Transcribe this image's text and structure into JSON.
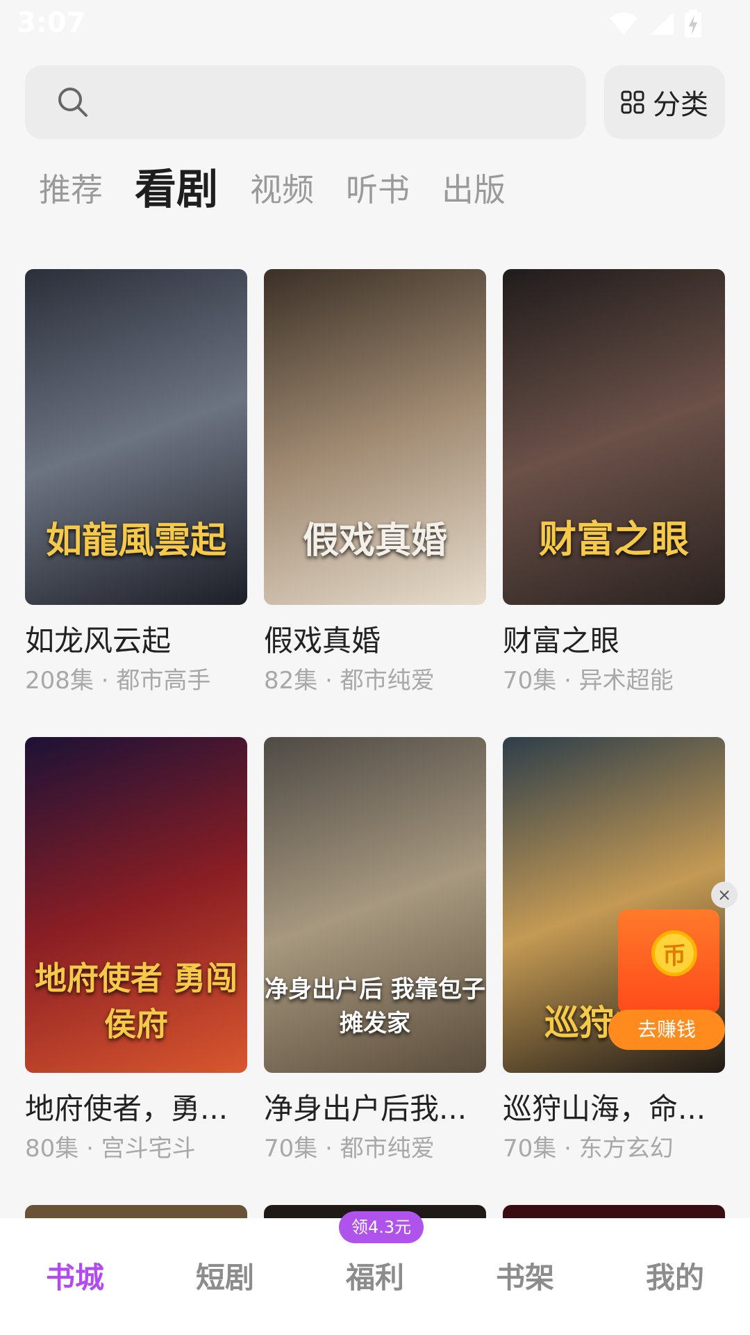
{
  "status_bar": {
    "time": "3:07"
  },
  "search": {
    "placeholder": ""
  },
  "category_button": {
    "label": "分类"
  },
  "tabs": [
    {
      "label": "推荐",
      "active": false
    },
    {
      "label": "看剧",
      "active": true
    },
    {
      "label": "视频",
      "active": false
    },
    {
      "label": "听书",
      "active": false
    },
    {
      "label": "出版",
      "active": false
    }
  ],
  "dramas": [
    {
      "poster_text": "如龍風雲起",
      "title": "如龙风云起",
      "meta": "208集 · 都市高手",
      "colors": [
        "#2b2f3a",
        "#6c7381",
        "#1d1f27"
      ]
    },
    {
      "poster_text": "假戏真婚",
      "title": "假戏真婚",
      "meta": "82集 · 都市纯爱",
      "colors": [
        "#3b3026",
        "#a08a72",
        "#e7dccc"
      ]
    },
    {
      "poster_text": "财富之眼",
      "title": "财富之眼",
      "meta": "70集 · 异术超能",
      "colors": [
        "#201c1c",
        "#6b5148",
        "#2a2220"
      ]
    },
    {
      "poster_text": "地府使者 勇闯侯府",
      "title": "地府使者，勇...",
      "meta": "80集 · 宫斗宅斗",
      "colors": [
        "#1c1236",
        "#8a1e24",
        "#d9572e"
      ]
    },
    {
      "poster_text": "净身出户后 我靠包子摊发家",
      "title": "净身出户后我...",
      "meta": "70集 · 都市纯爱",
      "colors": [
        "#4e4a45",
        "#a7987f",
        "#5b4d3c"
      ]
    },
    {
      "poster_text": "巡狩山海",
      "title": "巡狩山海，命...",
      "meta": "70集 · 东方玄幻",
      "colors": [
        "#2e3e4a",
        "#c49a54",
        "#1e1a16"
      ]
    }
  ],
  "earn_widget": {
    "coin": "币",
    "button_label": "去赚钱",
    "close": "×"
  },
  "bottom_nav": [
    {
      "label": "书城",
      "active": true
    },
    {
      "label": "短剧",
      "active": false
    },
    {
      "label": "福利",
      "active": false,
      "badge": "领4.3元"
    },
    {
      "label": "书架",
      "active": false
    },
    {
      "label": "我的",
      "active": false
    }
  ]
}
